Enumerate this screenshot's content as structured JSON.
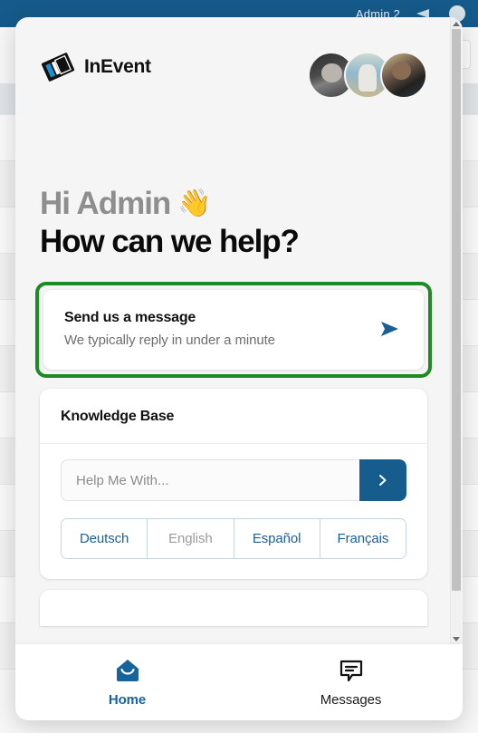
{
  "background_app": {
    "topbar": {
      "user_label": "Admin 2",
      "announcement_icon": "megaphone-icon",
      "avatar_icon": "user-avatar-icon"
    },
    "search_placeholder": ""
  },
  "messenger": {
    "brand": {
      "logo_icon": "inevent-logo-icon",
      "name": "InEvent"
    },
    "team_avatars": [
      {
        "name": "team-avatar-1"
      },
      {
        "name": "team-avatar-2"
      },
      {
        "name": "team-avatar-3"
      }
    ],
    "greeting": {
      "line1": "Hi Admin",
      "emoji": "👋",
      "line2": "How can we help?"
    },
    "send_message_card": {
      "title": "Send us a message",
      "subtitle": "We typically reply in under a minute",
      "arrow_icon": "send-arrow-icon",
      "highlighted": true,
      "highlight_color": "#1b8b23"
    },
    "knowledge_base": {
      "title": "Knowledge Base",
      "search_value": "",
      "search_placeholder": "Help Me With...",
      "submit_icon": "chevron-right-icon",
      "submit_color": "#165c8c",
      "languages": [
        {
          "label": "Deutsch",
          "current": false
        },
        {
          "label": "English",
          "current": true
        },
        {
          "label": "Español",
          "current": false
        },
        {
          "label": "Français",
          "current": false
        }
      ]
    },
    "scrollbar": {
      "up_icon": "scroll-up-arrow-icon",
      "down_icon": "scroll-down-arrow-icon"
    },
    "bottom_nav": [
      {
        "label": "Home",
        "icon": "home-icon",
        "active": true
      },
      {
        "label": "Messages",
        "icon": "messages-icon",
        "active": false
      }
    ]
  },
  "colors": {
    "brand_blue": "#165c8c",
    "topbar_blue": "#155a8a",
    "highlight_green": "#1b8b23",
    "panel_bg": "#f5f5f5"
  }
}
